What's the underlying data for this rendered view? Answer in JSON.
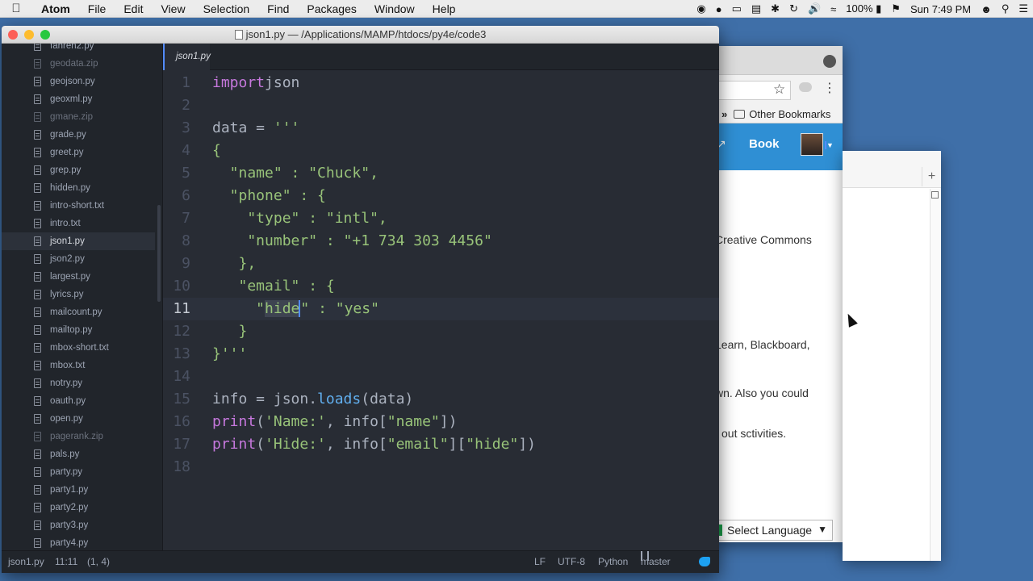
{
  "menubar": {
    "apple_icon": "apple-icon",
    "items": [
      "Atom",
      "File",
      "Edit",
      "View",
      "Selection",
      "Find",
      "Packages",
      "Window",
      "Help"
    ],
    "battery": "100%",
    "clock": "Sun 7:49 PM"
  },
  "atom": {
    "window_title": "json1.py — /Applications/MAMP/htdocs/py4e/code3",
    "tab_label": "json1.py",
    "tree": [
      {
        "name": "fahren2.py",
        "dim": false
      },
      {
        "name": "geodata.zip",
        "dim": true
      },
      {
        "name": "geojson.py",
        "dim": false
      },
      {
        "name": "geoxml.py",
        "dim": false
      },
      {
        "name": "gmane.zip",
        "dim": true
      },
      {
        "name": "grade.py",
        "dim": false
      },
      {
        "name": "greet.py",
        "dim": false
      },
      {
        "name": "grep.py",
        "dim": false
      },
      {
        "name": "hidden.py",
        "dim": false
      },
      {
        "name": "intro-short.txt",
        "dim": false
      },
      {
        "name": "intro.txt",
        "dim": false
      },
      {
        "name": "json1.py",
        "dim": false,
        "selected": true
      },
      {
        "name": "json2.py",
        "dim": false
      },
      {
        "name": "largest.py",
        "dim": false
      },
      {
        "name": "lyrics.py",
        "dim": false
      },
      {
        "name": "mailcount.py",
        "dim": false
      },
      {
        "name": "mailtop.py",
        "dim": false
      },
      {
        "name": "mbox-short.txt",
        "dim": false
      },
      {
        "name": "mbox.txt",
        "dim": false
      },
      {
        "name": "notry.py",
        "dim": false
      },
      {
        "name": "oauth.py",
        "dim": false
      },
      {
        "name": "open.py",
        "dim": false
      },
      {
        "name": "pagerank.zip",
        "dim": true
      },
      {
        "name": "pals.py",
        "dim": false
      },
      {
        "name": "party.py",
        "dim": false
      },
      {
        "name": "party1.py",
        "dim": false
      },
      {
        "name": "party2.py",
        "dim": false
      },
      {
        "name": "party3.py",
        "dim": false
      },
      {
        "name": "party4.py",
        "dim": false
      }
    ],
    "code_lines": [
      [
        [
          "kw",
          "import"
        ],
        [
          "",
          "json"
        ]
      ],
      [],
      [
        [
          "",
          "data = "
        ],
        [
          "str",
          "'''"
        ]
      ],
      [
        [
          "str",
          "{"
        ]
      ],
      [
        [
          "str",
          "  \"name\" : \"Chuck\","
        ]
      ],
      [
        [
          "str",
          "  \"phone\" : {"
        ]
      ],
      [
        [
          "str",
          "    \"type\" : \"intl\","
        ]
      ],
      [
        [
          "str",
          "    \"number\" : \"+1 734 303 4456\""
        ]
      ],
      [
        [
          "str",
          "   },"
        ]
      ],
      [
        [
          "str",
          "   \"email\" : {"
        ]
      ],
      [
        [
          "str",
          "     \""
        ],
        [
          "sel",
          "hide"
        ],
        [
          "str",
          "\" : \"yes\""
        ]
      ],
      [
        [
          "str",
          "   }"
        ]
      ],
      [
        [
          "str",
          "}'''"
        ]
      ],
      [],
      [
        [
          "",
          "info = json."
        ],
        [
          "fn",
          "loads"
        ],
        [
          "",
          "(data)"
        ]
      ],
      [
        [
          "kw",
          "print"
        ],
        [
          "",
          "("
        ],
        [
          "str",
          "'Name:'"
        ],
        [
          "",
          ", info["
        ],
        [
          "str",
          "\"name\""
        ],
        [
          "",
          "])"
        ]
      ],
      [
        [
          "kw",
          "print"
        ],
        [
          "",
          "("
        ],
        [
          "str",
          "'Hide:'"
        ],
        [
          "",
          ", info["
        ],
        [
          "str",
          "\"email\""
        ],
        [
          "",
          "]["
        ],
        [
          "str",
          "\"hide\""
        ],
        [
          "",
          "])"
        ]
      ],
      []
    ],
    "cursor_line": 11,
    "status": {
      "file": "json1.py",
      "position": "11:11",
      "selection": "(1, 4)",
      "line_ending": "LF",
      "encoding": "UTF-8",
      "grammar": "Python",
      "branch": "master"
    }
  },
  "browser": {
    "bookmarks_label": "Other Bookmarks",
    "nav_book": "Book",
    "text_lines": [
      "Creative Commons",
      "Learn, Blackboard,",
      "wn. Also you could",
      "out sctivities."
    ],
    "language_select": "Select Language"
  },
  "colors": {
    "editor_bg": "#282c34",
    "keyword": "#c678dd",
    "string": "#98c379",
    "function": "#61afef",
    "site_nav": "#2f8fd4"
  }
}
